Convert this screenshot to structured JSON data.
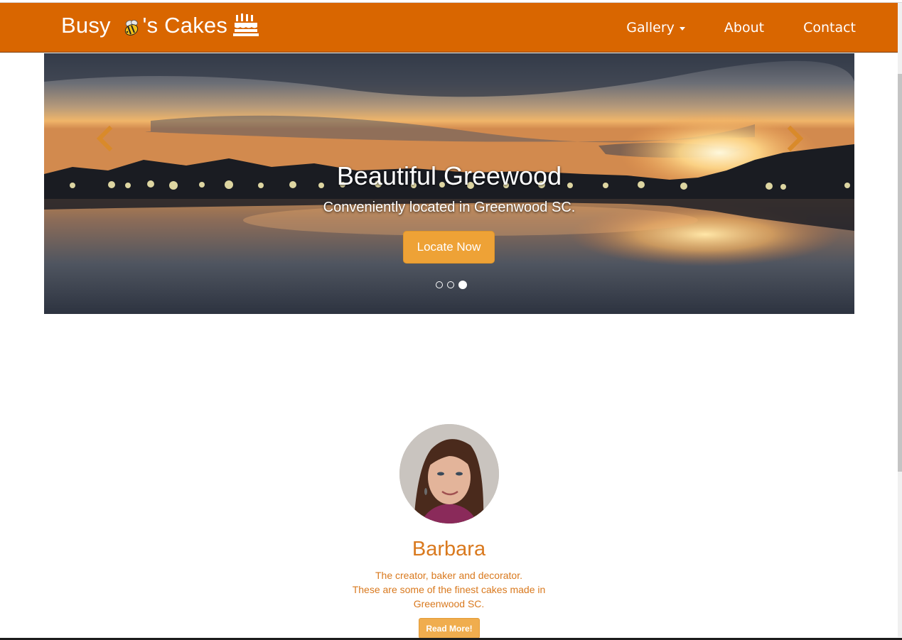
{
  "brand": {
    "prefix": "Busy ",
    "suffix": "'s Cakes",
    "icons": [
      "bee-icon",
      "birthday-cake-icon"
    ]
  },
  "nav": {
    "items": [
      {
        "label": "Gallery",
        "has_dropdown": true
      },
      {
        "label": "About"
      },
      {
        "label": "Contact"
      }
    ]
  },
  "carousel": {
    "title": "Beautiful Greewood",
    "subtitle": "Conveniently located in Greenwood SC.",
    "button": "Locate Now",
    "slides_count": 3,
    "active_slide": 3,
    "controls": [
      "chevron-left-icon",
      "chevron-right-icon"
    ]
  },
  "profile": {
    "name": "Barbara",
    "line1": "The creator, baker and decorator.",
    "line2": "These are some of the finest cakes made in",
    "line3": "Greenwood SC.",
    "button": "Read More!"
  },
  "colors": {
    "navbar": "#d96600",
    "accent": "#f0ad4e",
    "text_accent": "#d9791e"
  }
}
